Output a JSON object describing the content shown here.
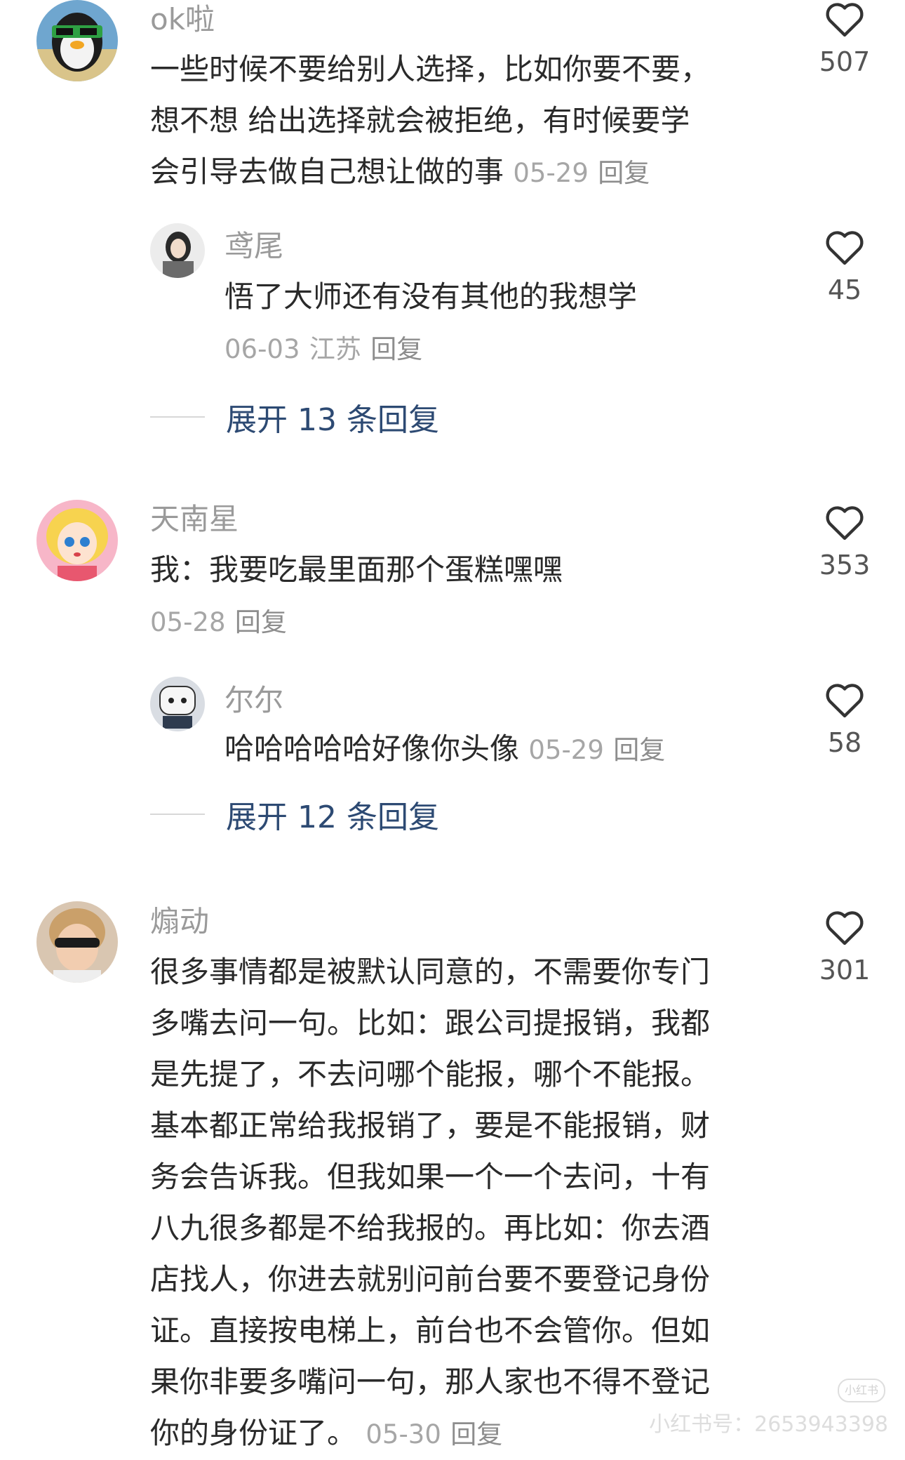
{
  "comments": [
    {
      "user": "ok啦",
      "lines": [
        "一些时候不要给别人选择，比如你要不要，",
        "想不想  给出选择就会被拒绝，有时候要学",
        "会引导去做自己想让做的事"
      ],
      "date": "05-29",
      "reply_label": "回复",
      "likes": "507",
      "replies": [
        {
          "user": "鸢尾",
          "lines": [
            "悟了大师还有没有其他的我想学"
          ],
          "date": "06-03",
          "location": "江苏",
          "reply_label": "回复",
          "likes": "45"
        }
      ],
      "expand_label": "展开 13 条回复"
    },
    {
      "user": "天南星",
      "lines": [
        "我：我要吃最里面那个蛋糕嘿嘿"
      ],
      "date": "05-28",
      "reply_label": "回复",
      "likes": "353",
      "replies": [
        {
          "user": "尔尔",
          "lines": [
            "哈哈哈哈哈好像你头像"
          ],
          "date": "05-29",
          "reply_label": "回复",
          "likes": "58"
        }
      ],
      "expand_label": "展开 12 条回复"
    },
    {
      "user": "煽动",
      "lines": [
        "很多事情都是被默认同意的，不需要你专门",
        "多嘴去问一句。比如：跟公司提报销，我都",
        "是先提了，不去问哪个能报，哪个不能报。",
        "基本都正常给我报销了，要是不能报销，财",
        "务会告诉我。但我如果一个一个去问，十有",
        "八九很多都是不给我报的。再比如：你去酒",
        "店找人，你进去就别问前台要不要登记身份",
        "证。直接按电梯上，前台也不会管你。但如",
        "果你非要多嘴问一句，那人家也不得不登记",
        "你的身份证了。"
      ],
      "date": "05-30",
      "reply_label": "回复",
      "likes": "301"
    }
  ],
  "watermark": {
    "badge": "小红书",
    "text": "小红书号：2653943398"
  },
  "colors": {
    "name": "#9a9a9a",
    "text": "#2a2a2a",
    "meta": "#a6a6a6",
    "expand": "#2d4a73"
  },
  "icons": [
    "heart-icon"
  ]
}
